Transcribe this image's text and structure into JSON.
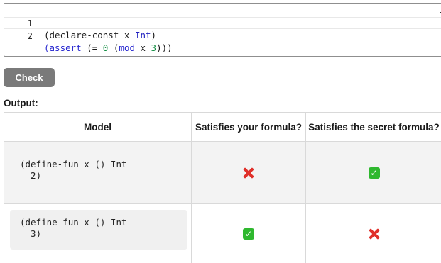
{
  "editor": {
    "lines": [
      {
        "number": "1",
        "text": "(declare-const x Int)"
      },
      {
        "number": "2",
        "text": "(assert (= 0 (mod x 3)))"
      }
    ]
  },
  "check_button": {
    "label": "Check"
  },
  "output": {
    "label": "Output:"
  },
  "table": {
    "headers": [
      "Model",
      "Satisfies your formula?",
      "Satisfies the secret formula?"
    ],
    "rows": [
      {
        "model": "(define-fun x () Int\n  2)",
        "satisfies_yours": false,
        "satisfies_secret": true
      },
      {
        "model": "(define-fun x () Int\n  3)",
        "satisfies_yours": true,
        "satisfies_secret": false
      }
    ]
  },
  "icons": {
    "false": "red-x-icon",
    "true": "green-check-icon"
  },
  "colors": {
    "button": "#7a7a7a",
    "x_mark": "#e0302a",
    "check_mark": "#2fb82f",
    "row_alt": "#f3f3f3"
  }
}
